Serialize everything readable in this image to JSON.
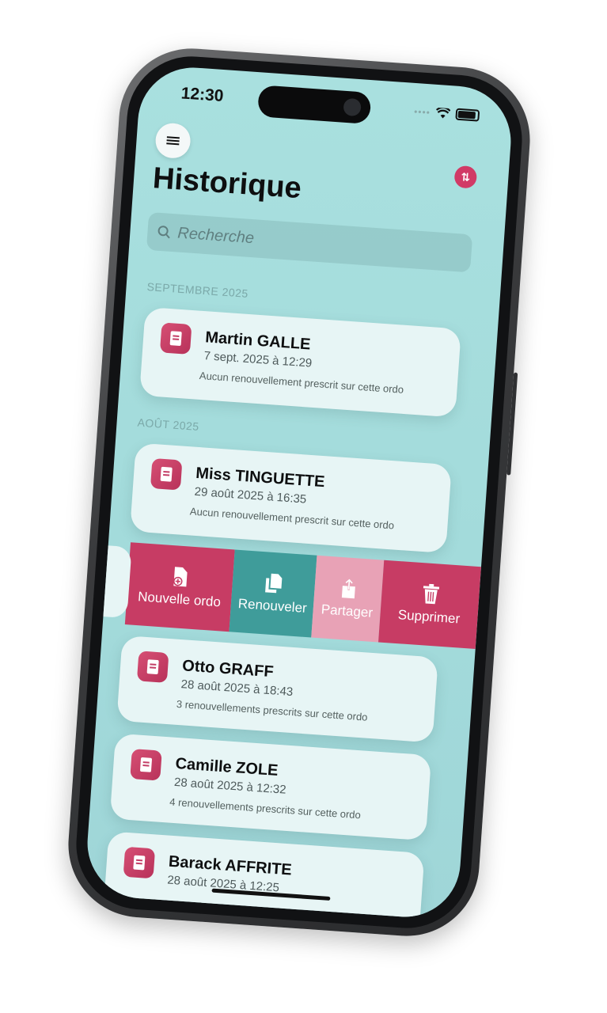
{
  "status": {
    "time": "12:30"
  },
  "header": {
    "title": "Historique"
  },
  "search": {
    "placeholder": "Recherche"
  },
  "sections": [
    {
      "label": "SEPTEMBRE 2025"
    },
    {
      "label": "AOÛT 2025"
    }
  ],
  "records": [
    {
      "name": "Martin GALLE",
      "date": "7 sept. 2025 à 12:29",
      "note": "Aucun renouvellement prescrit sur cette ordo"
    },
    {
      "name": "Miss TINGUETTE",
      "date": "29 août 2025 à 16:35",
      "note": "Aucun renouvellement prescrit sur cette ordo"
    },
    {
      "name": "Otto GRAFF",
      "date": "28 août 2025 à 18:43",
      "note": "3 renouvellements prescrits sur cette ordo"
    },
    {
      "name": "Camille ZOLE",
      "date": "28 août 2025 à 12:32",
      "note": "4 renouvellements prescrits sur cette ordo"
    },
    {
      "name": "Barack AFFRITE",
      "date": "28 août 2025 à 12:25",
      "note": ""
    }
  ],
  "swipe_actions": [
    {
      "label": "Nouvelle ordo",
      "icon": "new-document-icon",
      "color": "#c73c64"
    },
    {
      "label": "Renouveler",
      "icon": "copy-documents-icon",
      "color": "#3f9c9a"
    },
    {
      "label": "Partager",
      "icon": "share-icon",
      "color": "#e8a2b6"
    },
    {
      "label": "Supprimer",
      "icon": "trash-icon",
      "color": "#c73c64"
    }
  ],
  "colors": {
    "accent": "#d13a66",
    "background": "#a6dede",
    "card": "#e7f5f5"
  }
}
